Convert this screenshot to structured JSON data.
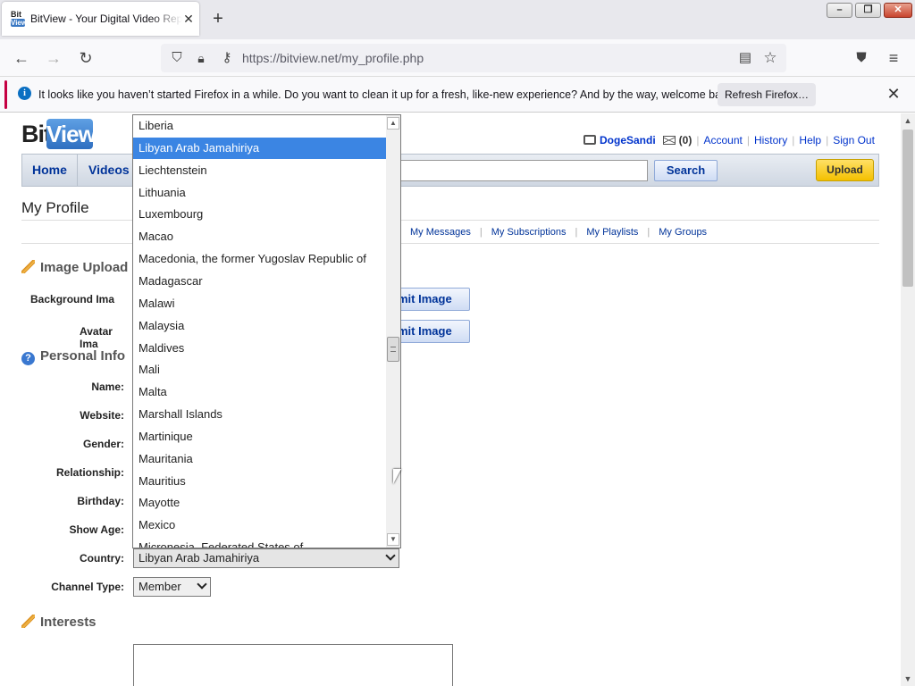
{
  "browser": {
    "tab_title": "BitView - Your Digital Video Repository",
    "favicon_top": "Bit",
    "favicon_bottom": "View",
    "url": "https://bitview.net/my_profile.php",
    "notice_text": "It looks like you haven’t started Firefox in a while. Do you want to clean it up for a fresh, like-new experience? And by the way, welcome back!",
    "refresh_label": "Refresh Firefox…"
  },
  "site": {
    "logo_bit": "Bit",
    "logo_view": "View",
    "username": "DogeSandi",
    "message_count": "(0)",
    "user_links": [
      "Account",
      "History",
      "Help",
      "Sign Out"
    ],
    "nav": [
      "Home",
      "Videos"
    ],
    "search_label": "Search",
    "upload_label": "Upload"
  },
  "profile": {
    "page_title": "My Profile",
    "sublinks": [
      "My Messages",
      "My Subscriptions",
      "My Playlists",
      "My Groups"
    ],
    "image_upload_title": "Image Upload",
    "background_label": "Background Ima",
    "avatar_label": "Avatar Ima",
    "submit_label": "mit Image",
    "personal_info_title": "Personal Info",
    "fields": [
      "Name:",
      "Website:",
      "Gender:",
      "Relationship:",
      "Birthday:",
      "Show Age:",
      "Country:",
      "Channel Type:"
    ],
    "country_value": "Libyan Arab Jamahiriya",
    "channel_type_value": "Member",
    "interests_title": "Interests"
  },
  "country_dropdown": {
    "options": [
      "Liberia",
      "Libyan Arab Jamahiriya",
      "Liechtenstein",
      "Lithuania",
      "Luxembourg",
      "Macao",
      "Macedonia, the former Yugoslav Republic of",
      "Madagascar",
      "Malawi",
      "Malaysia",
      "Maldives",
      "Mali",
      "Malta",
      "Marshall Islands",
      "Martinique",
      "Mauritania",
      "Mauritius",
      "Mayotte",
      "Mexico",
      "Micronesia, Federated States of"
    ],
    "selected": "Libyan Arab Jamahiriya"
  }
}
